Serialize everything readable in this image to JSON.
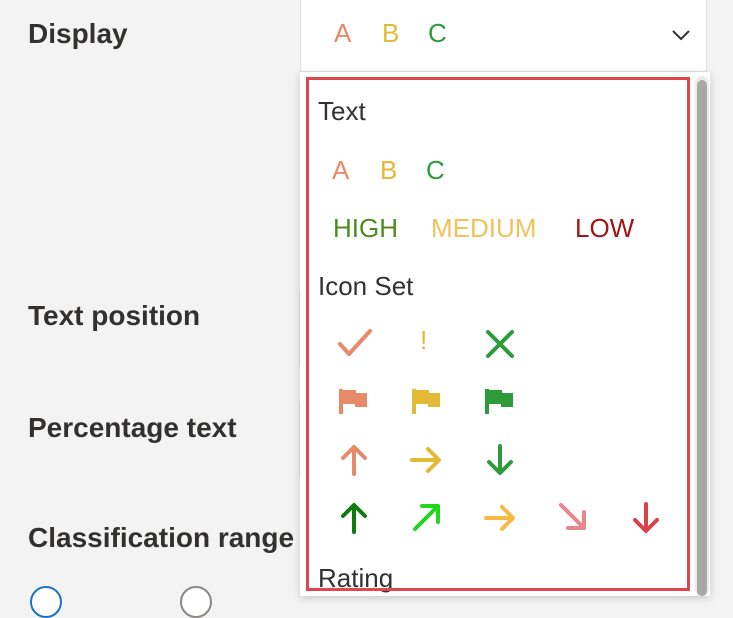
{
  "labels": {
    "display": "Display",
    "text_position": "Text position",
    "percentage_text": "Percentage text",
    "classification_range": "Classification range"
  },
  "display_select": {
    "selected": [
      "A",
      "B",
      "C"
    ],
    "selected_colors": [
      "#e8896a",
      "#e3b935",
      "#2e9b3a"
    ]
  },
  "menu": {
    "sections": {
      "text": "Text",
      "icon_set": "Icon Set",
      "rating": "Rating"
    },
    "text_options": [
      {
        "items": [
          "A",
          "B",
          "C"
        ],
        "colors": [
          "#e8896a",
          "#e3b935",
          "#2e9b3a"
        ]
      },
      {
        "items": [
          "HIGH",
          "MEDIUM",
          "LOW"
        ],
        "colors": [
          "#4f8a1e",
          "#f0c25a",
          "#a31515"
        ]
      }
    ],
    "icon_sets": [
      {
        "icons": [
          "checkmark-icon",
          "exclamation-icon",
          "cross-icon"
        ],
        "colors": [
          "#e8896a",
          "#e3b935",
          "#2e9b3a"
        ]
      },
      {
        "icons": [
          "flag-icon",
          "flag-icon",
          "flag-icon"
        ],
        "colors": [
          "#e8896a",
          "#e3b935",
          "#2e9b3a"
        ]
      },
      {
        "icons": [
          "arrow-up-icon",
          "arrow-right-icon",
          "arrow-down-icon"
        ],
        "colors": [
          "#e8896a",
          "#e3b935",
          "#2e9b3a"
        ]
      },
      {
        "icons": [
          "arrow-up-icon",
          "arrow-up-right-icon",
          "arrow-right-icon",
          "arrow-down-right-icon",
          "arrow-down-icon"
        ],
        "colors": [
          "#0f7b0f",
          "#1ed71e",
          "#f7b944",
          "#e9858b",
          "#d9414b"
        ]
      }
    ],
    "exclamation_glyph": "!"
  },
  "highlight_color": "#e0464e"
}
